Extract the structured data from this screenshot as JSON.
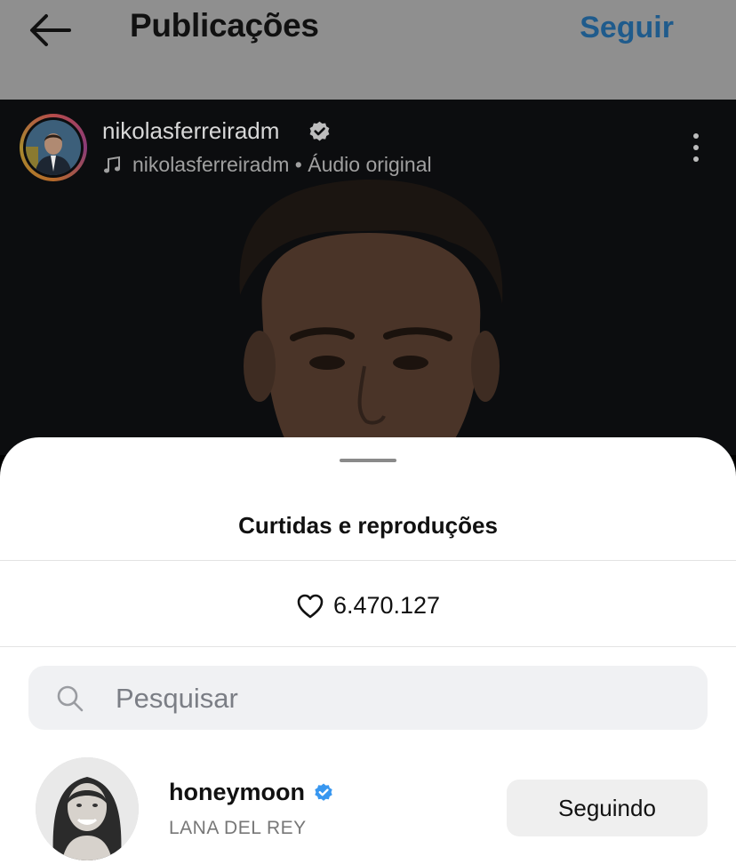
{
  "header": {
    "title": "Publicações",
    "follow_label": "Seguir",
    "back_icon": "arrow-left-icon"
  },
  "post": {
    "username": "nikolasferreiradm",
    "audio_text": "nikolasferreiradm • Áudio original",
    "verified_icon": "verified-badge-icon",
    "music_icon": "music-note-icon",
    "more_icon": "more-vertical-icon"
  },
  "sheet": {
    "title": "Curtidas e reproduções",
    "likes_count": "6.470.127",
    "heart_icon": "heart-outline-icon",
    "search": {
      "placeholder": "Pesquisar",
      "value": ""
    },
    "users": [
      {
        "username": "honeymoon",
        "subtitle": "LANA DEL REY",
        "verified": true,
        "button_label": "Seguindo"
      }
    ]
  },
  "colors": {
    "link_blue": "#1f5b8c",
    "verified_blue": "#3897f0",
    "dim_overlay": "#8f8f8f",
    "button_bg": "#efefef"
  }
}
